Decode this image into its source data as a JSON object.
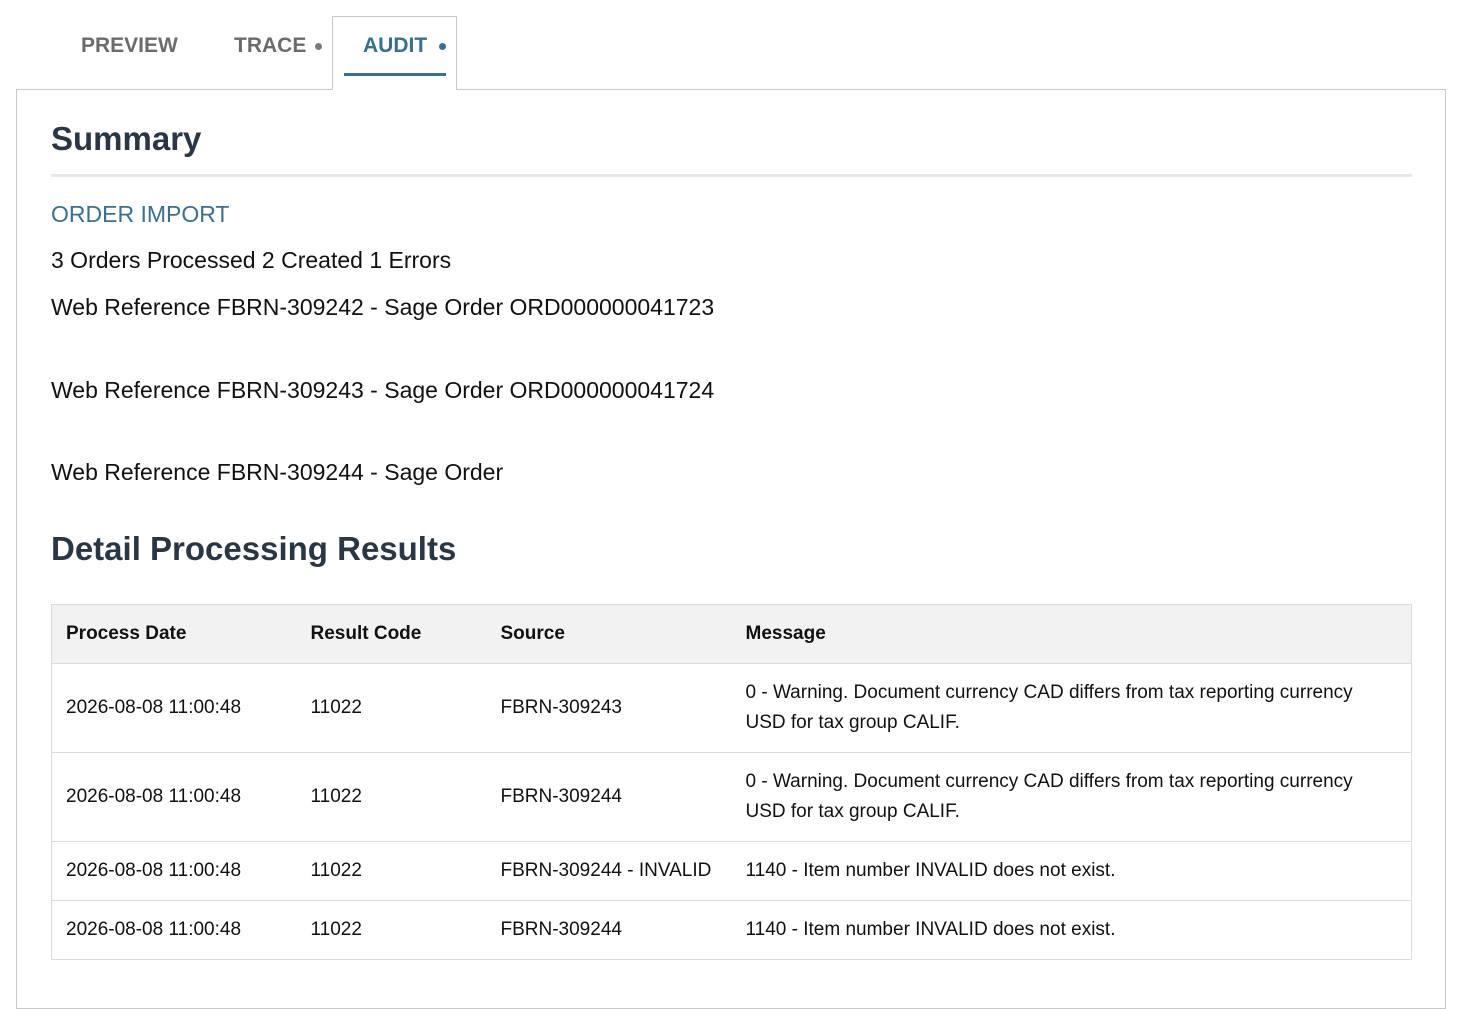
{
  "tabs": [
    {
      "label": "PREVIEW",
      "has_dot": false,
      "active": false
    },
    {
      "label": "TRACE",
      "has_dot": true,
      "active": false
    },
    {
      "label": "AUDIT",
      "has_dot": true,
      "active": true
    }
  ],
  "summary": {
    "heading": "Summary",
    "section_label": "ORDER IMPORT",
    "stats": "3 Orders Processed 2 Created 1 Errors",
    "references": [
      "Web Reference FBRN-309242 - Sage Order ORD000000041723",
      "Web Reference FBRN-309243 - Sage Order ORD000000041724",
      "Web Reference FBRN-309244 - Sage Order"
    ]
  },
  "detail": {
    "heading": "Detail Processing Results",
    "columns": [
      "Process Date",
      "Result Code",
      "Source",
      "Message"
    ],
    "rows": [
      {
        "date": "2026-08-08 11:00:48",
        "code": "11022",
        "source": "FBRN-309243",
        "message": "0 - Warning. Document currency CAD differs from tax reporting currency USD for tax group CALIF."
      },
      {
        "date": "2026-08-08 11:00:48",
        "code": "11022",
        "source": "FBRN-309244",
        "message": "0 - Warning. Document currency CAD differs from tax reporting currency USD for tax group CALIF."
      },
      {
        "date": "2026-08-08 11:00:48",
        "code": "11022",
        "source": "FBRN-309244 - INVALID",
        "message": "1140 - Item number INVALID does not exist."
      },
      {
        "date": "2026-08-08 11:00:48",
        "code": "11022",
        "source": "FBRN-309244",
        "message": "1140 - Item number INVALID does not exist."
      }
    ]
  },
  "colors": {
    "accent": "#3b6f91",
    "heading": "#2b3644",
    "tab_inactive": "#6b6b6b",
    "table_header_bg": "#f2f2f2",
    "border": "#c8c8c8"
  }
}
